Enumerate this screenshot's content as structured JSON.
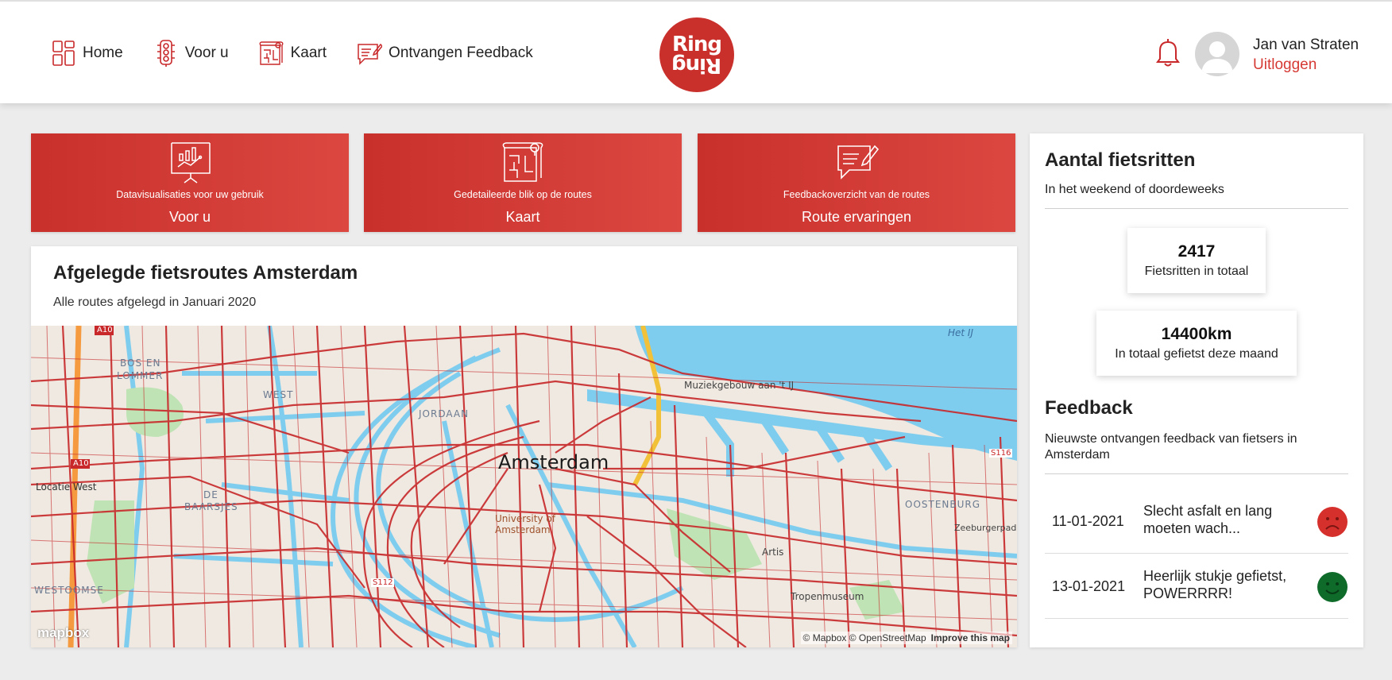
{
  "nav": {
    "items": [
      {
        "label": "Home",
        "icon": "dashboard-icon"
      },
      {
        "label": "Voor u",
        "icon": "traffic-light-icon"
      },
      {
        "label": "Kaart",
        "icon": "map-icon"
      },
      {
        "label": "Ontvangen Feedback",
        "icon": "feedback-icon"
      }
    ]
  },
  "logo": {
    "top": "Ring",
    "bottom": "Ring"
  },
  "user": {
    "name": "Jan van Straten",
    "logout": "Uitloggen"
  },
  "tiles": [
    {
      "subtitle": "Datavisualisaties voor uw gebruik",
      "title": "Voor u",
      "icon": "presentation-chart-icon"
    },
    {
      "subtitle": "Gedetaileerde blik op de routes",
      "title": "Kaart",
      "icon": "map-icon"
    },
    {
      "subtitle": "Feedbackoverzicht van de routes",
      "title": "Route ervaringen",
      "icon": "feedback-icon"
    }
  ],
  "map_card": {
    "title": "Afgelegde fietsroutes Amsterdam",
    "subtitle": "Alle routes afgelegd in Januari 2020",
    "city_label": "Amsterdam",
    "labels": {
      "bos_en": "BOS EN",
      "lommer": "LOMMER",
      "west": "WEST",
      "jordaan": "JORDAAN",
      "de": "DE",
      "baarsjes": "BAARSJES",
      "locatie_west": "Locatie West",
      "oostenburg": "OOSTENBURG",
      "het_ij": "Het IJ",
      "muziekgebouw": "Muziekgebouw aan 't IJ",
      "university": "University of Amsterdam",
      "artis": "Artis",
      "tropenmuseum": "Tropenmuseum",
      "zeeburgerpad": "Zeeburgerpad",
      "westoomse": "WESTOOMSE",
      "a10": "A10",
      "s116": "S116",
      "s112": "S112"
    },
    "attribution": "© Mapbox © OpenStreetMap",
    "improve": "Improve this map",
    "mapbox_logo": "mapbox",
    "colors": {
      "water": "#7fcdee",
      "route": "#c8282a",
      "park": "#bfe3b4",
      "land": "#efe9e1",
      "highway": "#f59a3f"
    }
  },
  "rides": {
    "title": "Aantal fietsritten",
    "subtitle": "In het weekend of doordeweeks",
    "total": {
      "value": "2417",
      "label": "Fietsritten in totaal"
    },
    "distance": {
      "value": "14400km",
      "label": "In totaal gefietst deze maand"
    }
  },
  "feedback": {
    "title": "Feedback",
    "subtitle": "Nieuwste ontvangen feedback van fietsers in Amsterdam",
    "items": [
      {
        "date": "11-01-2021",
        "text": "Slecht asfalt en lang moeten wach...",
        "mood": "sad-face-icon",
        "color": "#d6302c"
      },
      {
        "date": "13-01-2021",
        "text": "Heerlijk stukje gefietst, POWERRRR!",
        "mood": "happy-face-icon",
        "color": "#0e6b2a"
      }
    ]
  },
  "accent_color": "#d63a34"
}
